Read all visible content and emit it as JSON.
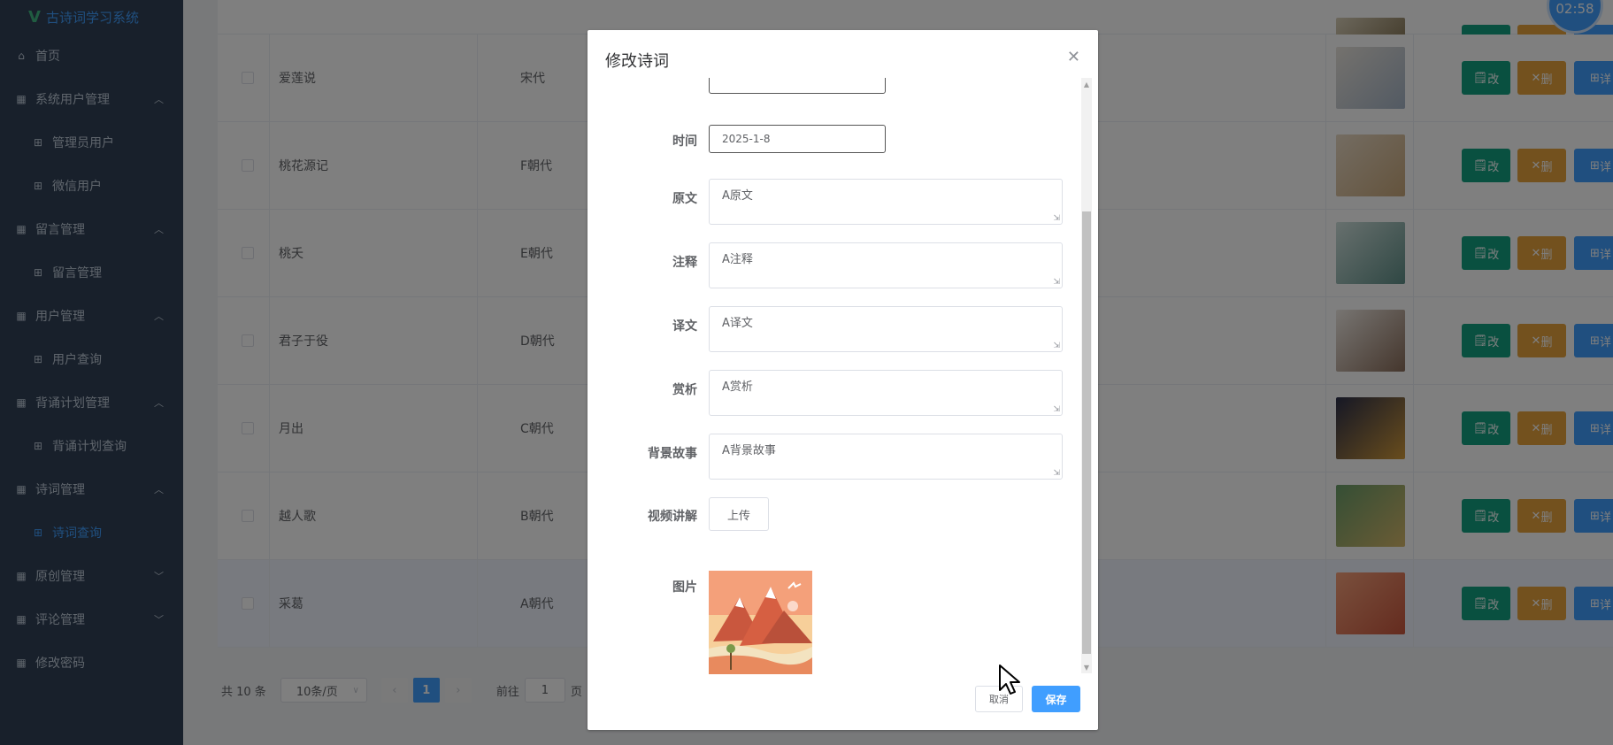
{
  "sidebar": {
    "app_title": "古诗词学习系统",
    "items": [
      {
        "label": "首页",
        "icon": "home-icon"
      },
      {
        "label": "系统用户管理",
        "icon": "grid-icon",
        "arrow": "^"
      },
      {
        "label": "管理员用户",
        "icon": "apps-icon"
      },
      {
        "label": "微信用户",
        "icon": "apps-icon"
      },
      {
        "label": "留言管理",
        "icon": "grid-icon",
        "arrow": "^"
      },
      {
        "label": "留言管理",
        "icon": "apps-icon"
      },
      {
        "label": "用户管理",
        "icon": "grid-icon",
        "arrow": "^"
      },
      {
        "label": "用户查询",
        "icon": "apps-icon"
      },
      {
        "label": "背诵计划管理",
        "icon": "grid-icon",
        "arrow": "^"
      },
      {
        "label": "背诵计划查询",
        "icon": "apps-icon"
      },
      {
        "label": "诗词管理",
        "icon": "grid-icon",
        "arrow": "^"
      },
      {
        "label": "诗词查询",
        "icon": "apps-icon",
        "active": true
      },
      {
        "label": "原创管理",
        "icon": "grid-icon",
        "arrow": "v"
      },
      {
        "label": "评论管理",
        "icon": "grid-icon",
        "arrow": "v"
      },
      {
        "label": "修改密码",
        "icon": "grid-icon"
      }
    ]
  },
  "timer": "02:58",
  "table": {
    "rows": [
      {
        "title": "爱莲说",
        "dynasty": "宋代"
      },
      {
        "title": "桃花源记",
        "dynasty": "F朝代"
      },
      {
        "title": "桃夭",
        "dynasty": "E朝代"
      },
      {
        "title": "君子于役",
        "dynasty": "D朝代"
      },
      {
        "title": "月出",
        "dynasty": "C朝代"
      },
      {
        "title": "越人歌",
        "dynasty": "B朝代"
      },
      {
        "title": "采葛",
        "dynasty": "A朝代"
      }
    ],
    "actions": {
      "edit": "改",
      "delete": "删",
      "detail": "详"
    }
  },
  "pagination": {
    "total": "共 10 条",
    "page_size": "10条/页",
    "current": "1",
    "goto_label": "前往",
    "goto_value": "1",
    "page_suffix": "页"
  },
  "dialog": {
    "title": "修改诗词",
    "fields": {
      "time_label": "时间",
      "time_value": "2025-1-8",
      "original_label": "原文",
      "original_value": "A原文",
      "notes_label": "注释",
      "notes_value": "A注释",
      "translation_label": "译文",
      "translation_value": "A译文",
      "appreciation_label": "赏析",
      "appreciation_value": "A赏析",
      "background_label": "背景故事",
      "background_value": "A背景故事",
      "video_label": "视频讲解",
      "upload_label": "上传",
      "image_label": "图片"
    },
    "cancel": "取消",
    "save": "保存"
  }
}
